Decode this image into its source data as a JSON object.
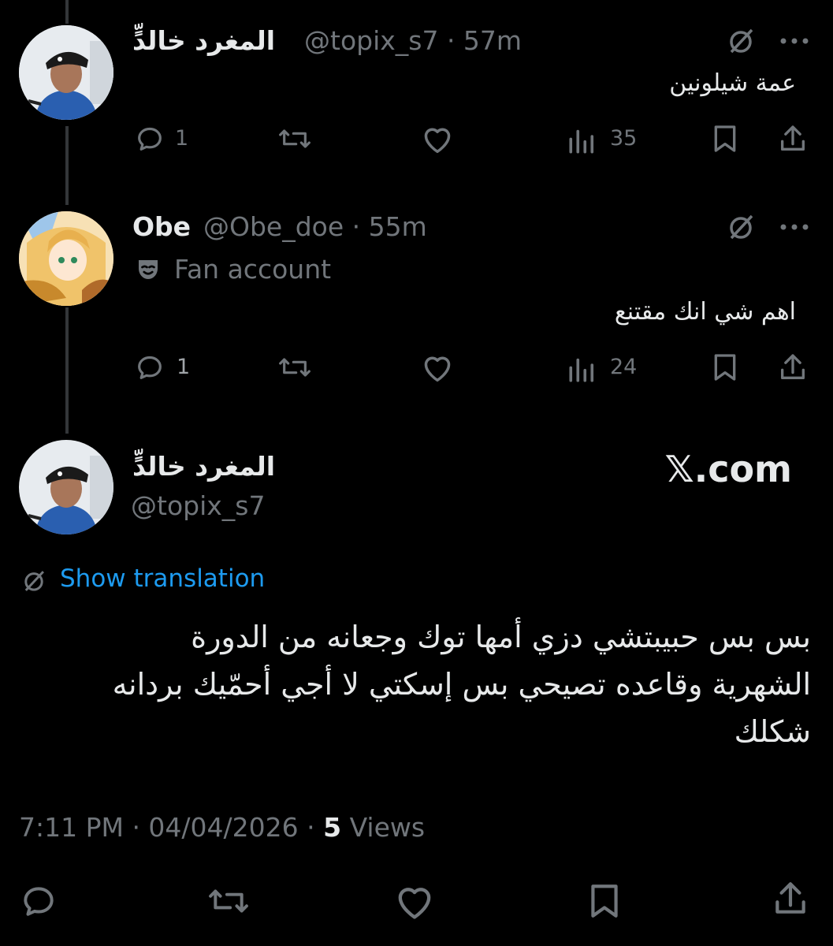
{
  "tweets": [
    {
      "name": "المغرد خالدٍّ",
      "meta": "@topix_s7 · 57m",
      "text": "عمة شيلونين",
      "replies": "1",
      "views": "35"
    },
    {
      "name": "Obe",
      "meta": "@Obe_doe · 55m",
      "badge": "Fan account",
      "text": "اهم شي انك مقتنع",
      "replies": "1",
      "views": "24"
    }
  ],
  "main": {
    "name": "المغرد خالدٍّ",
    "handle": "@topix_s7",
    "watermark": "𝕏.com",
    "translate_label": "Show translation",
    "text_lines": [
      "بس بس حبيبتشي دزي أمها توك وجعانه من الدورة",
      "الشهرية وقاعده تصيحي بس إسكتي لا أجي أحمّيك بردانه",
      "شكلك"
    ],
    "time": "7:11 PM · 04/04/2026 · ",
    "views_count": "5",
    "views_label": " Views"
  },
  "colors": {
    "link": "#1d9bf0",
    "muted": "#71767b",
    "text": "#e7e9ea",
    "background": "#000000"
  }
}
